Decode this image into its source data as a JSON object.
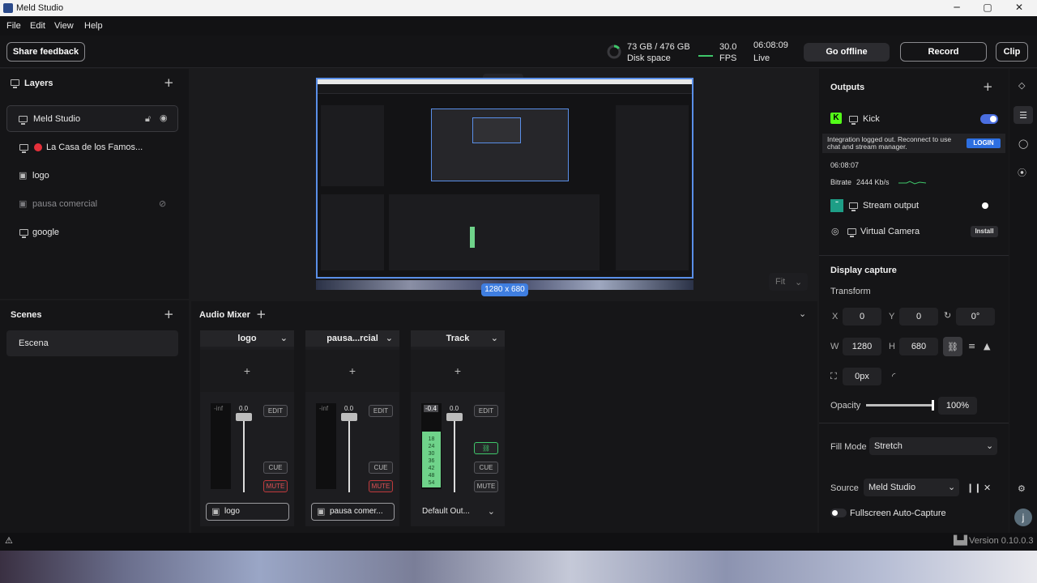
{
  "window": {
    "title": "Meld Studio",
    "minimize": "─",
    "maximize": "▢",
    "close": "✕"
  },
  "menu": [
    "File",
    "Edit",
    "View",
    "Help"
  ],
  "topbar": {
    "feedback": "Share feedback",
    "disk_value": "73 GB / 476 GB",
    "disk_label": "Disk space",
    "disk_fraction": 0.15,
    "fps_value": "30.0",
    "fps_label": "FPS",
    "live_time": "06:08:09",
    "live_label": "Live",
    "go_offline": "Go offline",
    "record": "Record",
    "clip": "Clip"
  },
  "layers": {
    "title": "Layers",
    "items": [
      {
        "label": "Meld Studio",
        "icon": "monitor-icon"
      },
      {
        "label": "La Casa de los Famos...",
        "icon": "monitor-icon"
      },
      {
        "label": "logo",
        "icon": "media-icon"
      },
      {
        "label": "pausa comercial",
        "icon": "media-icon"
      },
      {
        "label": "google",
        "icon": "monitor-icon"
      }
    ]
  },
  "scenes": {
    "title": "Scenes",
    "items": [
      "Escena"
    ]
  },
  "preview": {
    "size_label": "1280 x 680",
    "fit": "Fit"
  },
  "mixer": {
    "title": "Audio Mixer",
    "tracks": [
      {
        "name": "logo",
        "meter_top": "-inf",
        "fader_value": "0.0",
        "edit": "EDIT",
        "cue": "CUE",
        "mute": "MUTE",
        "source": "logo",
        "level": 0
      },
      {
        "name": "pausa...rcial",
        "meter_top": "-inf",
        "fader_value": "0.0",
        "edit": "EDIT",
        "cue": "CUE",
        "mute": "MUTE",
        "source": "pausa comer...",
        "level": 0
      },
      {
        "name": "Track",
        "meter_top": "-0.4",
        "fader_value": "0.0",
        "edit": "EDIT",
        "cue": "CUE",
        "mute": "MUTE",
        "source": "Default Out...",
        "level": 0.68
      }
    ],
    "meter_ticks": [
      "18",
      "24",
      "30",
      "36",
      "42",
      "48",
      "54"
    ]
  },
  "outputs": {
    "title": "Outputs",
    "kick_label": "Kick",
    "kick_note": "Integration logged out. Reconnect to use chat and stream manager.",
    "login": "LOGIN",
    "kick_time": "06:08:07",
    "bitrate_label": "Bitrate",
    "bitrate_value": "2444 Kb/s",
    "stream_output": "Stream output",
    "virtual_camera": "Virtual Camera",
    "install": "Install"
  },
  "display": {
    "title": "Display capture",
    "transform": "Transform",
    "x_label": "X",
    "x": "0",
    "y_label": "Y",
    "y": "0",
    "rotation": "0°",
    "w_label": "W",
    "w": "1280",
    "h_label": "H",
    "h": "680",
    "crop": "0px",
    "opacity_label": "Opacity",
    "opacity": "100%",
    "opacity_value": 1.0,
    "fill_mode_label": "Fill Mode",
    "fill_mode": "Stretch",
    "source_label": "Source",
    "source": "Meld Studio",
    "fullscreen": "Fullscreen Auto-Capture"
  },
  "status": {
    "version": "Version 0.10.0.3",
    "avatar": "j"
  }
}
